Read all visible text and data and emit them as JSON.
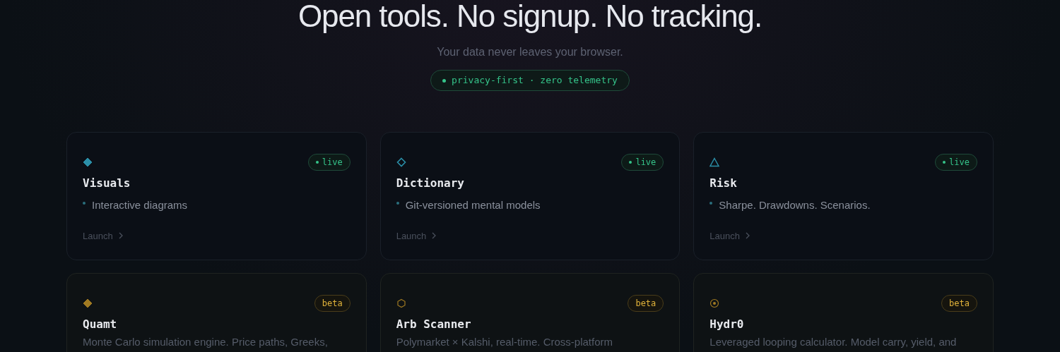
{
  "hero": {
    "headline": "Open tools. No signup. No tracking.",
    "subtitle": "Your data never leaves your browser.",
    "pill": "privacy-first · zero telemetry"
  },
  "tools": [
    {
      "kind": "live",
      "badge": "live",
      "title": "Visuals",
      "description": "Interactive diagrams",
      "action": "Launch"
    },
    {
      "kind": "live",
      "badge": "live",
      "title": "Dictionary",
      "description": "Git-versioned mental models",
      "action": "Launch"
    },
    {
      "kind": "live",
      "badge": "live",
      "title": "Risk",
      "description": "Sharpe. Drawdowns. Scenarios.",
      "action": "Launch"
    },
    {
      "kind": "beta",
      "badge": "beta",
      "title": "Quamt",
      "description": "Monte Carlo simulation engine. Price paths, Greeks,"
    },
    {
      "kind": "beta",
      "badge": "beta",
      "title": "Arb Scanner",
      "description": "Polymarket × Kalshi, real-time. Cross-platform"
    },
    {
      "kind": "beta",
      "badge": "beta",
      "title": "Hydr0",
      "description": "Leveraged looping calculator. Model carry, yield, and"
    }
  ]
}
